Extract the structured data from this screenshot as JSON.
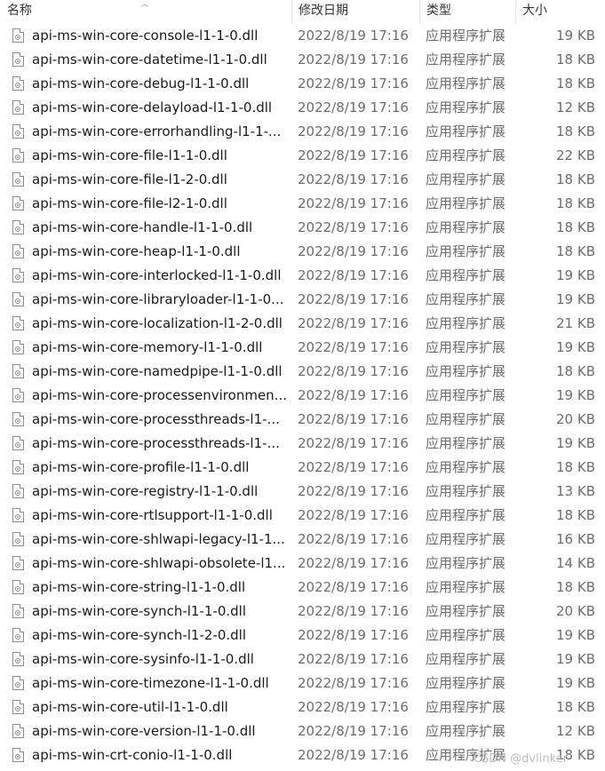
{
  "columns": {
    "name": "名称",
    "date": "修改日期",
    "type": "类型",
    "size": "大小"
  },
  "files": [
    {
      "name": "api-ms-win-core-console-l1-1-0.dll",
      "date": "2022/8/19 17:16",
      "type": "应用程序扩展",
      "size": "19 KB"
    },
    {
      "name": "api-ms-win-core-datetime-l1-1-0.dll",
      "date": "2022/8/19 17:16",
      "type": "应用程序扩展",
      "size": "18 KB"
    },
    {
      "name": "api-ms-win-core-debug-l1-1-0.dll",
      "date": "2022/8/19 17:16",
      "type": "应用程序扩展",
      "size": "18 KB"
    },
    {
      "name": "api-ms-win-core-delayload-l1-1-0.dll",
      "date": "2022/8/19 17:16",
      "type": "应用程序扩展",
      "size": "12 KB"
    },
    {
      "name": "api-ms-win-core-errorhandling-l1-1-...",
      "date": "2022/8/19 17:16",
      "type": "应用程序扩展",
      "size": "18 KB"
    },
    {
      "name": "api-ms-win-core-file-l1-1-0.dll",
      "date": "2022/8/19 17:16",
      "type": "应用程序扩展",
      "size": "22 KB"
    },
    {
      "name": "api-ms-win-core-file-l1-2-0.dll",
      "date": "2022/8/19 17:16",
      "type": "应用程序扩展",
      "size": "18 KB"
    },
    {
      "name": "api-ms-win-core-file-l2-1-0.dll",
      "date": "2022/8/19 17:16",
      "type": "应用程序扩展",
      "size": "18 KB"
    },
    {
      "name": "api-ms-win-core-handle-l1-1-0.dll",
      "date": "2022/8/19 17:16",
      "type": "应用程序扩展",
      "size": "18 KB"
    },
    {
      "name": "api-ms-win-core-heap-l1-1-0.dll",
      "date": "2022/8/19 17:16",
      "type": "应用程序扩展",
      "size": "18 KB"
    },
    {
      "name": "api-ms-win-core-interlocked-l1-1-0.dll",
      "date": "2022/8/19 17:16",
      "type": "应用程序扩展",
      "size": "19 KB"
    },
    {
      "name": "api-ms-win-core-libraryloader-l1-1-0...",
      "date": "2022/8/19 17:16",
      "type": "应用程序扩展",
      "size": "19 KB"
    },
    {
      "name": "api-ms-win-core-localization-l1-2-0.dll",
      "date": "2022/8/19 17:16",
      "type": "应用程序扩展",
      "size": "21 KB"
    },
    {
      "name": "api-ms-win-core-memory-l1-1-0.dll",
      "date": "2022/8/19 17:16",
      "type": "应用程序扩展",
      "size": "19 KB"
    },
    {
      "name": "api-ms-win-core-namedpipe-l1-1-0.dll",
      "date": "2022/8/19 17:16",
      "type": "应用程序扩展",
      "size": "18 KB"
    },
    {
      "name": "api-ms-win-core-processenvironmen...",
      "date": "2022/8/19 17:16",
      "type": "应用程序扩展",
      "size": "19 KB"
    },
    {
      "name": "api-ms-win-core-processthreads-l1-...",
      "date": "2022/8/19 17:16",
      "type": "应用程序扩展",
      "size": "20 KB"
    },
    {
      "name": "api-ms-win-core-processthreads-l1-...",
      "date": "2022/8/19 17:16",
      "type": "应用程序扩展",
      "size": "19 KB"
    },
    {
      "name": "api-ms-win-core-profile-l1-1-0.dll",
      "date": "2022/8/19 17:16",
      "type": "应用程序扩展",
      "size": "18 KB"
    },
    {
      "name": "api-ms-win-core-registry-l1-1-0.dll",
      "date": "2022/8/19 17:16",
      "type": "应用程序扩展",
      "size": "13 KB"
    },
    {
      "name": "api-ms-win-core-rtlsupport-l1-1-0.dll",
      "date": "2022/8/19 17:16",
      "type": "应用程序扩展",
      "size": "18 KB"
    },
    {
      "name": "api-ms-win-core-shlwapi-legacy-l1-1...",
      "date": "2022/8/19 17:16",
      "type": "应用程序扩展",
      "size": "16 KB"
    },
    {
      "name": "api-ms-win-core-shlwapi-obsolete-l1...",
      "date": "2022/8/19 17:16",
      "type": "应用程序扩展",
      "size": "14 KB"
    },
    {
      "name": "api-ms-win-core-string-l1-1-0.dll",
      "date": "2022/8/19 17:16",
      "type": "应用程序扩展",
      "size": "18 KB"
    },
    {
      "name": "api-ms-win-core-synch-l1-1-0.dll",
      "date": "2022/8/19 17:16",
      "type": "应用程序扩展",
      "size": "20 KB"
    },
    {
      "name": "api-ms-win-core-synch-l1-2-0.dll",
      "date": "2022/8/19 17:16",
      "type": "应用程序扩展",
      "size": "19 KB"
    },
    {
      "name": "api-ms-win-core-sysinfo-l1-1-0.dll",
      "date": "2022/8/19 17:16",
      "type": "应用程序扩展",
      "size": "19 KB"
    },
    {
      "name": "api-ms-win-core-timezone-l1-1-0.dll",
      "date": "2022/8/19 17:16",
      "type": "应用程序扩展",
      "size": "19 KB"
    },
    {
      "name": "api-ms-win-core-util-l1-1-0.dll",
      "date": "2022/8/19 17:16",
      "type": "应用程序扩展",
      "size": "18 KB"
    },
    {
      "name": "api-ms-win-core-version-l1-1-0.dll",
      "date": "2022/8/19 17:16",
      "type": "应用程序扩展",
      "size": "12 KB"
    },
    {
      "name": "api-ms-win-crt-conio-l1-1-0.dll",
      "date": "2022/8/19 17:16",
      "type": "应用程序扩展",
      "size": "18 KB"
    }
  ],
  "file_icon": "dll-file-icon",
  "watermark": "CSDN @dvlinker"
}
